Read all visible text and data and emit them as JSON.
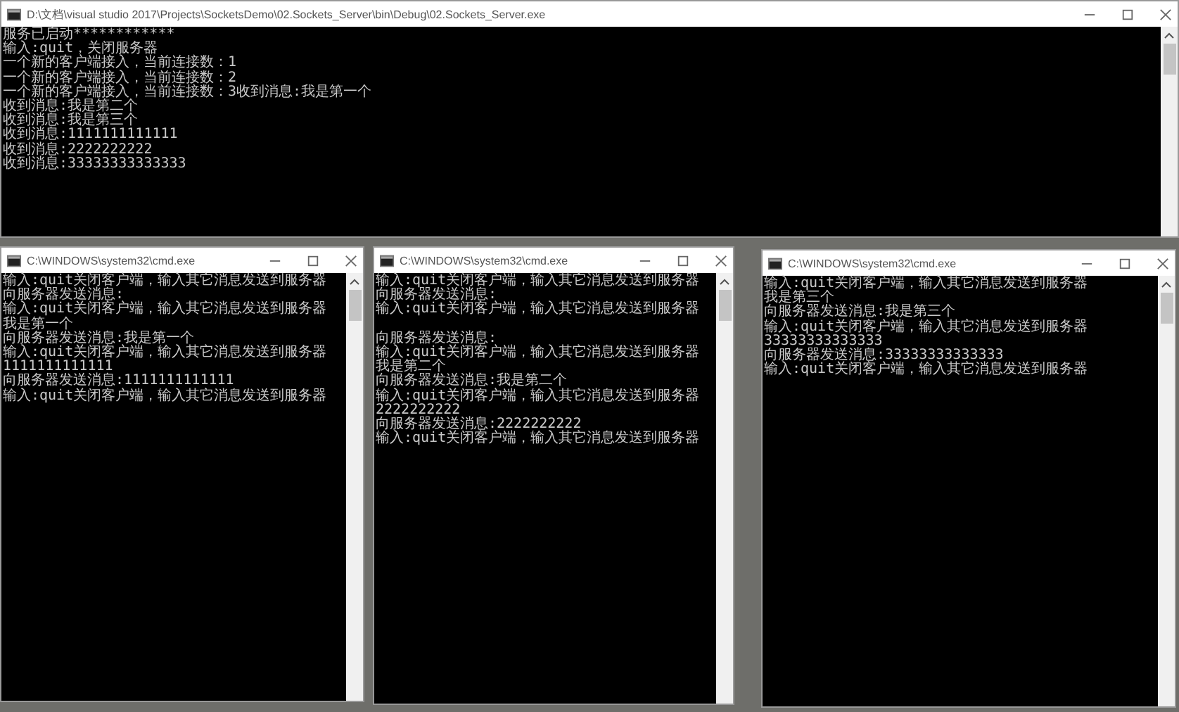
{
  "windows": [
    {
      "title": "D:\\文档\\visual studio 2017\\Projects\\SocketsDemo\\02.Sockets_Server\\bin\\Debug\\02.Sockets_Server.exe",
      "lines": [
        {
          "text": "服务已启动************"
        },
        {
          "text": "输入:quit，关闭服务器"
        },
        {
          "text": "一个新的客户端接入，当前连接数：1"
        },
        {
          "text": "一个新的客户端接入，当前连接数：2"
        },
        {
          "text": "一个新的客户端接入，当前连接数：3收到消息:我是第一个"
        },
        {
          "text": "收到消息:我是第二个"
        },
        {
          "text": "收到消息:我是第三个"
        },
        {
          "text": "收到消息:1111111111111"
        },
        {
          "text": "收到消息:2222222222"
        },
        {
          "text": "收到消息:33333333333333"
        }
      ]
    },
    {
      "title": "C:\\WINDOWS\\system32\\cmd.exe",
      "lines": [
        {
          "text": "输入:quit关闭客户端，输入其它消息发送到服务器"
        },
        {
          "text": "向服务器发送消息:"
        },
        {
          "text": "输入:quit关闭客户端，输入其它消息发送到服务器"
        },
        {
          "text": "我是第一个"
        },
        {
          "text": "向服务器发送消息:我是第一个"
        },
        {
          "text": "输入:quit关闭客户端，输入其它消息发送到服务器"
        },
        {
          "text": "1111111111111"
        },
        {
          "text": "向服务器发送消息:1111111111111"
        },
        {
          "text": "输入:quit关闭客户端，输入其它消息发送到服务器"
        }
      ]
    },
    {
      "title": "C:\\WINDOWS\\system32\\cmd.exe",
      "lines": [
        {
          "text": "输入:quit关闭客户端，输入其它消息发送到服务器"
        },
        {
          "text": "向服务器发送消息:"
        },
        {
          "text": "输入:quit关闭客户端，输入其它消息发送到服务器"
        },
        {
          "text": "向服务器发送消息:",
          "blank_before": true
        },
        {
          "text": "输入:quit关闭客户端，输入其它消息发送到服务器"
        },
        {
          "text": "我是第二个"
        },
        {
          "text": "向服务器发送消息:我是第二个"
        },
        {
          "text": "输入:quit关闭客户端，输入其它消息发送到服务器"
        },
        {
          "text": "2222222222"
        },
        {
          "text": "向服务器发送消息:2222222222"
        },
        {
          "text": "输入:quit关闭客户端，输入其它消息发送到服务器"
        }
      ]
    },
    {
      "title": "C:\\WINDOWS\\system32\\cmd.exe",
      "lines": [
        {
          "text": "输入:quit关闭客户端，输入其它消息发送到服务器"
        },
        {
          "text": "我是第三个"
        },
        {
          "text": "向服务器发送消息:我是第三个"
        },
        {
          "text": "输入:quit关闭客户端，输入其它消息发送到服务器"
        },
        {
          "text": "33333333333333"
        },
        {
          "text": "向服务器发送消息:33333333333333"
        },
        {
          "text": "输入:quit关闭客户端，输入其它消息发送到服务器"
        }
      ]
    }
  ]
}
